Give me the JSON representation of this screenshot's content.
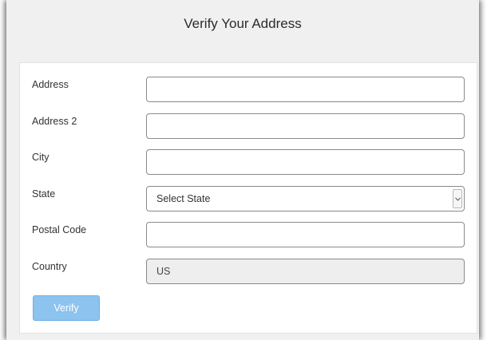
{
  "dialog": {
    "title": "Verify Your Address"
  },
  "form": {
    "fields": [
      {
        "label": "Address",
        "value": "",
        "placeholder": ""
      },
      {
        "label": "Address 2",
        "value": "",
        "placeholder": ""
      },
      {
        "label": "City",
        "value": "",
        "placeholder": ""
      },
      {
        "label": "State",
        "selected": "Select State"
      },
      {
        "label": "Postal Code",
        "value": "",
        "placeholder": ""
      },
      {
        "label": "Country",
        "value": "US"
      }
    ],
    "verify_label": "Verify"
  },
  "icons": {
    "select_arrow": "chevron-down-icon"
  },
  "colors": {
    "button_bg": "#8cc3ef",
    "dialog_bg": "#f0f0f0",
    "readonly_bg": "#eeeeee"
  }
}
